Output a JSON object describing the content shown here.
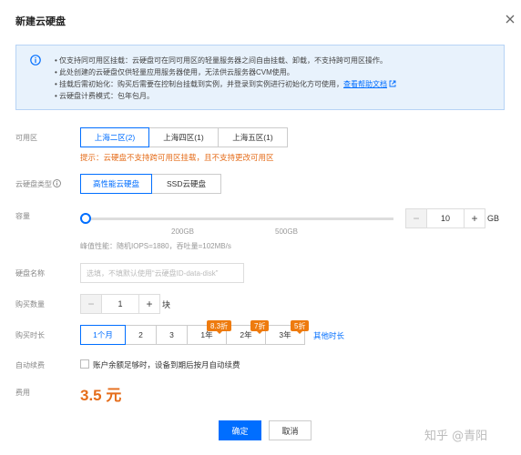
{
  "dialog": {
    "title": "新建云硬盘"
  },
  "notice": {
    "lines": [
      "• 仅支持同可用区挂载：云硬盘可在同可用区的轻量服务器之间自由挂载、卸载，不支持跨可用区操作。",
      "• 此处创建的云硬盘仅供轻量应用服务器使用，无法供云服务器CVM使用。",
      "• 挂载后需初始化：购买后需要在控制台挂载到实例，并登录到实例进行初始化方可使用，",
      "• 云硬盘计费模式：包年包月。"
    ],
    "help_link": "查看帮助文档"
  },
  "zone": {
    "label": "可用区",
    "options": [
      "上海二区(2)",
      "上海四区(1)",
      "上海五区(1)"
    ],
    "selected": 0,
    "hint": "提示：云硬盘不支持跨可用区挂载，且不支持更改可用区"
  },
  "disk_type": {
    "label": "云硬盘类型",
    "options": [
      "高性能云硬盘",
      "SSD云硬盘"
    ],
    "selected": 0
  },
  "capacity": {
    "label": "容量",
    "value": "10",
    "unit": "GB",
    "ticks": [
      "200GB",
      "500GB"
    ],
    "performance": "峰值性能：随机IOPS=1880，吞吐量=102MB/s"
  },
  "disk_name": {
    "label": "硬盘名称",
    "placeholder": "选填，不填默认使用“云硬盘ID-data-disk”"
  },
  "quantity": {
    "label": "购买数量",
    "value": "1",
    "unit": "块"
  },
  "duration": {
    "label": "购买时长",
    "options": [
      "1个月",
      "2",
      "3",
      "1年",
      "2年",
      "3年"
    ],
    "selected": 0,
    "badges": [
      "8.3折",
      "7折",
      "5折"
    ],
    "more": "其他时长"
  },
  "auto_renew": {
    "label": "自动续费",
    "text": "账户余额足够时，设备到期后按月自动续费"
  },
  "fee": {
    "label": "费用",
    "value": "3.5 元"
  },
  "actions": {
    "confirm": "确定",
    "cancel": "取消"
  },
  "watermark": "知乎 @青阳",
  "colors": {
    "primary": "#006eff",
    "warning": "#e56d1b",
    "notice_bg": "#e8f2fc"
  }
}
